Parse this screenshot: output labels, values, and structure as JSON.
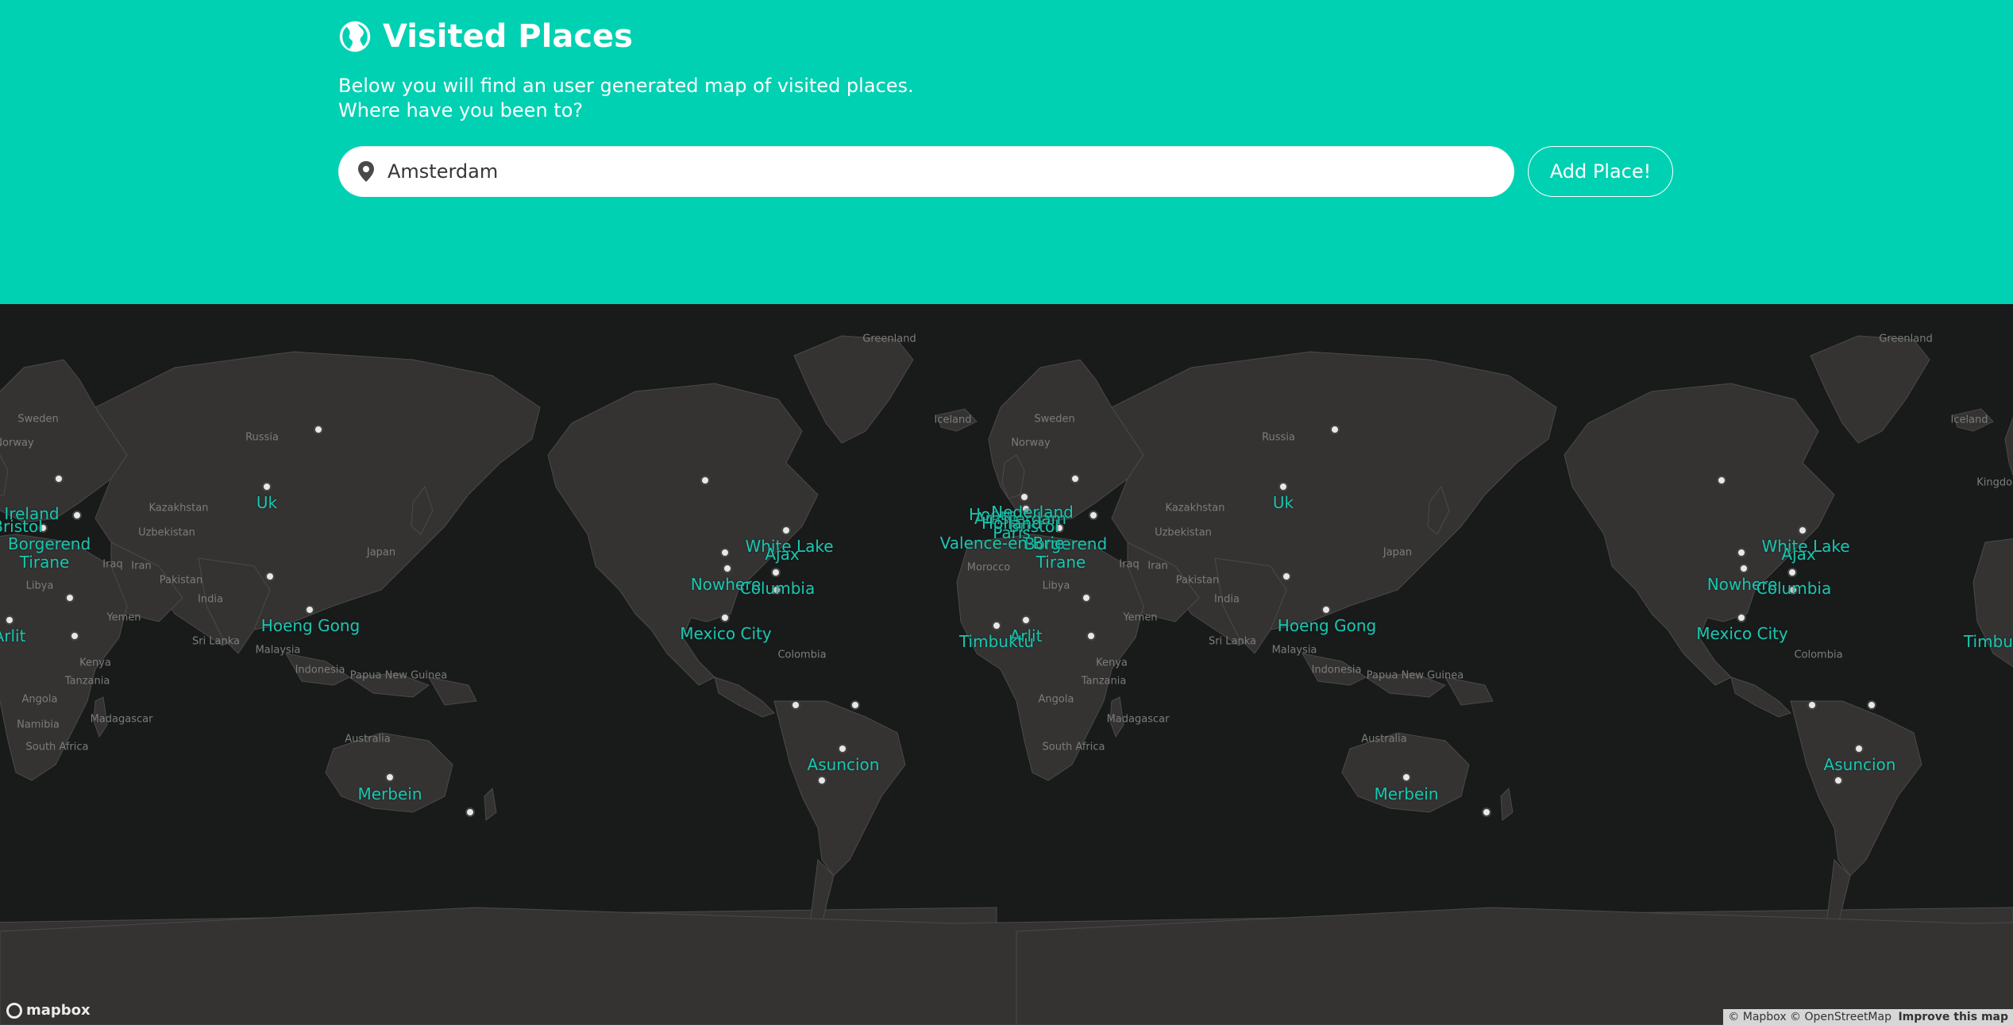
{
  "header": {
    "title": "Visited Places",
    "subtitle_line1": "Below you will find an user generated map of visited places.",
    "subtitle_line2": "Where have you been to?",
    "search_value": "Amsterdam",
    "add_button_label": "Add Place!",
    "accent_color": "#00d1b2"
  },
  "map": {
    "background_color": "#191a1a",
    "land_color": "#343332",
    "label_color": "#19c7b0",
    "country_labels": [
      "Sweden",
      "Norway",
      "Russia",
      "Kazakhstan",
      "Uzbekistan",
      "Iraq",
      "Iran",
      "Libya",
      "Pakistan",
      "India",
      "Japan",
      "Yemen",
      "Sri Lanka",
      "Malaysia",
      "Indonesia",
      "Papua New Guinea",
      "Kenya",
      "Tanzania",
      "Angola",
      "Namibia",
      "Madagascar",
      "South Africa",
      "Australia",
      "Greenland",
      "Iceland",
      "Colombia",
      "Morocco",
      "Kingdom"
    ],
    "place_labels": [
      "Uk",
      "Hoeng Gong",
      "Merbein",
      "Tirane",
      "Arlit",
      "White Lake",
      "Ajax",
      "Nowhere",
      "Columbia",
      "Mexico City",
      "Asuncion",
      "Valence-en-Brie",
      "Timbuktu",
      "Paris",
      "Borgerend",
      "Bristol",
      "Hoorn",
      "Amsterdam",
      "Holland",
      "Ireland",
      "Nederland"
    ]
  },
  "footer": {
    "logo_text": "mapbox",
    "attribution": "© Mapbox © OpenStreetMap",
    "improve_link": "Improve this map"
  }
}
